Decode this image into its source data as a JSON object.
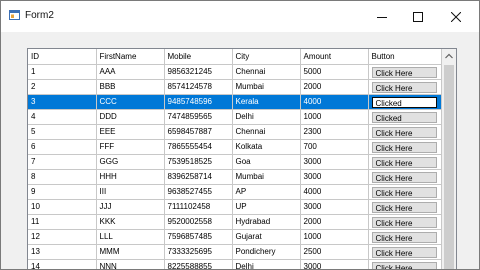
{
  "window": {
    "title": "Form2",
    "minimize_glyph": "—",
    "maximize_glyph": "☐",
    "close_glyph": "✕"
  },
  "grid": {
    "columns": [
      "ID",
      "FirstName",
      "Mobile",
      "City",
      "Amount",
      "Button"
    ],
    "selected_row": 2,
    "rows": [
      {
        "id": "1",
        "name": "AAA",
        "mobile": "9856321245",
        "city": "Chennai",
        "amount": "5000",
        "button": "Click Here"
      },
      {
        "id": "2",
        "name": "BBB",
        "mobile": "8574124578",
        "city": "Mumbai",
        "amount": "2000",
        "button": "Click Here"
      },
      {
        "id": "3",
        "name": "CCC",
        "mobile": "9485748596",
        "city": "Kerala",
        "amount": "4000",
        "button": "Clicked"
      },
      {
        "id": "4",
        "name": "DDD",
        "mobile": "7474859565",
        "city": "Delhi",
        "amount": "1000",
        "button": "Clicked"
      },
      {
        "id": "5",
        "name": "EEE",
        "mobile": "6598457887",
        "city": "Chennai",
        "amount": "2300",
        "button": "Click Here"
      },
      {
        "id": "6",
        "name": "FFF",
        "mobile": "7865555454",
        "city": "Kolkata",
        "amount": "700",
        "button": "Click Here"
      },
      {
        "id": "7",
        "name": "GGG",
        "mobile": "7539518525",
        "city": "Goa",
        "amount": "3000",
        "button": "Click Here"
      },
      {
        "id": "8",
        "name": "HHH",
        "mobile": "8396258714",
        "city": "Mumbai",
        "amount": "3000",
        "button": "Click Here"
      },
      {
        "id": "9",
        "name": "III",
        "mobile": "9638527455",
        "city": "AP",
        "amount": "4000",
        "button": "Click Here"
      },
      {
        "id": "10",
        "name": "JJJ",
        "mobile": "7111102458",
        "city": "UP",
        "amount": "3000",
        "button": "Click Here"
      },
      {
        "id": "11",
        "name": "KKK",
        "mobile": "9520002558",
        "city": "Hydrabad",
        "amount": "2000",
        "button": "Click Here"
      },
      {
        "id": "12",
        "name": "LLL",
        "mobile": "7596857485",
        "city": "Gujarat",
        "amount": "1000",
        "button": "Click Here"
      },
      {
        "id": "13",
        "name": "MMM",
        "mobile": "7333325695",
        "city": "Pondichery",
        "amount": "2500",
        "button": "Click Here"
      },
      {
        "id": "14",
        "name": "NNN",
        "mobile": "8225588855",
        "city": "Delhi",
        "amount": "3000",
        "button": "Click Here"
      }
    ]
  },
  "colors": {
    "selection": "#0078d7",
    "window_bg": "#f0f0f0",
    "button_face": "#e1e1e1"
  }
}
